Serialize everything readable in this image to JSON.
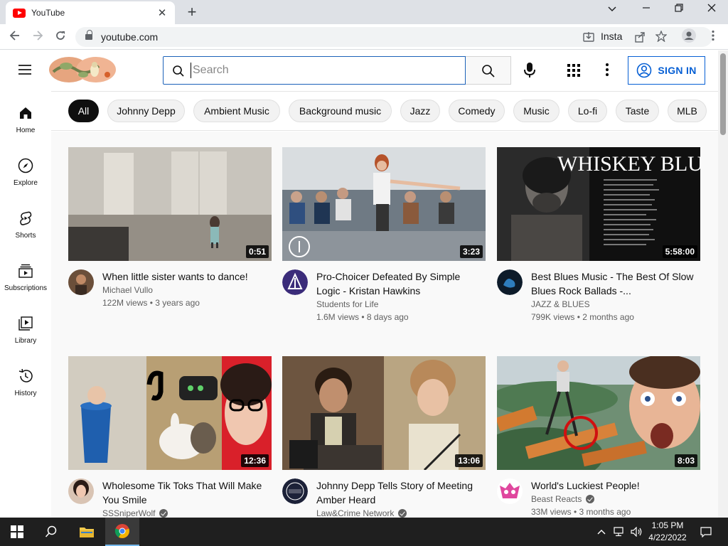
{
  "browser": {
    "tab_title": "YouTube",
    "tab_close": "✕",
    "new_tab": "+",
    "url": "youtube.com",
    "insta_label": "Insta",
    "window_controls": {
      "minimize": "─",
      "restore": "❐",
      "close": "✕",
      "chevron": "⌄"
    }
  },
  "header": {
    "search_placeholder": "Search",
    "sign_in": "SIGN IN"
  },
  "chips": [
    "All",
    "Johnny Depp",
    "Ambient Music",
    "Background music",
    "Jazz",
    "Comedy",
    "Music",
    "Lo-fi",
    "Taste",
    "MLB"
  ],
  "guide": [
    {
      "label": "Home",
      "icon": "home-icon"
    },
    {
      "label": "Explore",
      "icon": "compass-icon"
    },
    {
      "label": "Shorts",
      "icon": "shorts-icon"
    },
    {
      "label": "Subscriptions",
      "icon": "subscriptions-icon"
    },
    {
      "label": "Library",
      "icon": "library-icon"
    },
    {
      "label": "History",
      "icon": "history-icon"
    }
  ],
  "videos": [
    {
      "title": "When little sister wants to dance!",
      "channel": "Michael Vullo",
      "stats": "122M views • 3 years ago",
      "duration": "0:51",
      "verified": false
    },
    {
      "title": "Pro-Choicer Defeated By Simple Logic - Kristan Hawkins",
      "channel": "Students for Life",
      "stats": "1.6M views • 8 days ago",
      "duration": "3:23",
      "verified": false
    },
    {
      "title": "Best Blues Music - The Best Of Slow Blues Rock Ballads -...",
      "channel": "JAZZ & BLUES",
      "stats": "799K views • 2 months ago",
      "duration": "5:58:00",
      "verified": false,
      "thumb_text": "WHISKEY BLUES"
    },
    {
      "title": "Wholesome Tik Toks That Will Make You Smile",
      "channel": "SSSniperWolf",
      "stats": "",
      "duration": "12:36",
      "verified": true
    },
    {
      "title": "Johnny Depp Tells Story of Meeting Amber Heard",
      "channel": "Law&Crime Network",
      "stats": "",
      "duration": "13:06",
      "verified": true
    },
    {
      "title": "World's Luckiest People!",
      "channel": "Beast Reacts",
      "stats": "33M views • 3 months ago",
      "duration": "8:03",
      "verified": true
    }
  ],
  "taskbar": {
    "time": "1:05 PM",
    "date": "4/22/2022"
  },
  "colors": {
    "brand_red": "#ff0000",
    "link_blue": "#065fd4",
    "chip_active": "#0f0f0f"
  }
}
